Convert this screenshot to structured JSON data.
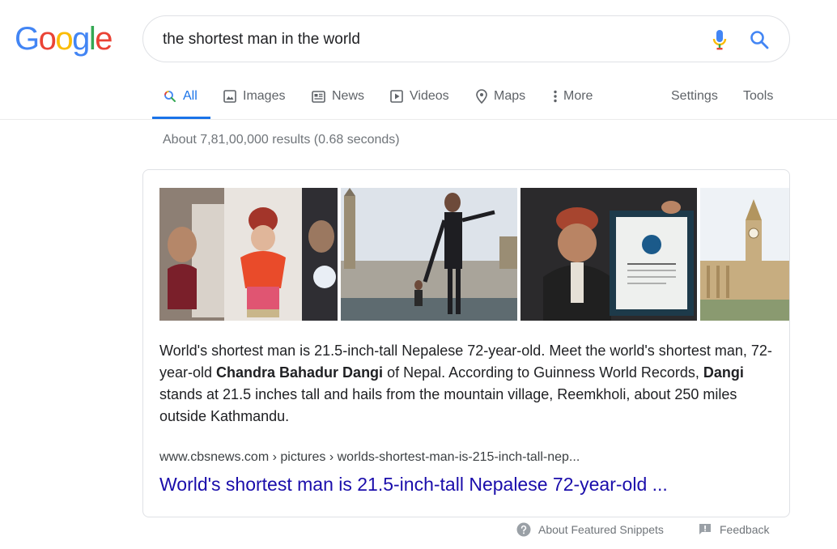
{
  "logo": {
    "letters": [
      "G",
      "o",
      "o",
      "g",
      "l",
      "e"
    ],
    "colors": [
      "#4285f4",
      "#ea4335",
      "#fbbc05",
      "#4285f4",
      "#34a853",
      "#ea4335"
    ]
  },
  "search": {
    "query": "the shortest man in the world"
  },
  "tabs": [
    {
      "label": "All",
      "icon": "search-icon"
    },
    {
      "label": "Images",
      "icon": "image-icon"
    },
    {
      "label": "News",
      "icon": "news-icon"
    },
    {
      "label": "Videos",
      "icon": "video-icon"
    },
    {
      "label": "Maps",
      "icon": "map-pin-icon"
    },
    {
      "label": "More",
      "icon": "more-vert-icon"
    }
  ],
  "tools": {
    "settings": "Settings",
    "tools": "Tools"
  },
  "result_stats": "About 7,81,00,000 results (0.68 seconds)",
  "snippet": {
    "part1": "World's shortest man is 21.5-inch-tall Nepalese 72-year-old. Meet the world's shortest man, 72-year-old ",
    "bold1": "Chandra Bahadur Dangi",
    "part2": " of Nepal. According to Guinness World Records, ",
    "bold2": "Dangi",
    "part3": " stands at 21.5 inches tall and hails from the mountain village, Reemkholi, about 250 miles outside Kathmandu.",
    "cite": "www.cbsnews.com › pictures › worlds-shortest-man-is-215-inch-tall-nep...",
    "title": "World's shortest man is 21.5-inch-tall Nepalese 72-year-old ..."
  },
  "footer": {
    "about": "About Featured Snippets",
    "feedback": "Feedback"
  },
  "colors": {
    "accent": "#1a73e8",
    "link": "#1a0dab",
    "muted": "#70757a"
  }
}
